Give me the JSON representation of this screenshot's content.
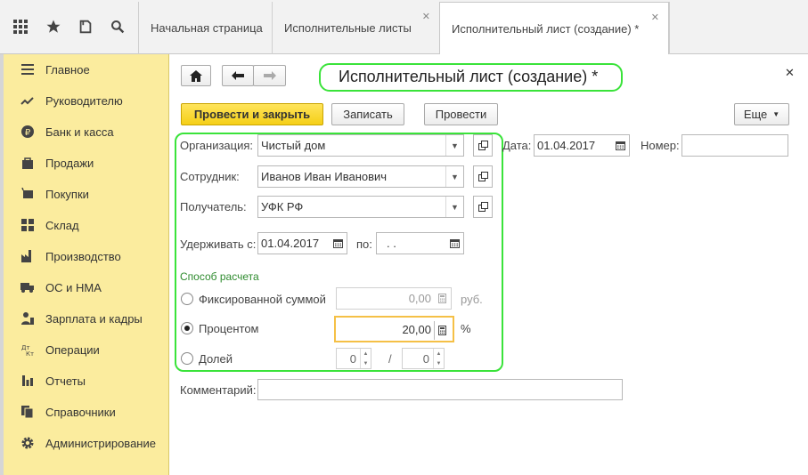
{
  "tabs": [
    {
      "label": "Начальная страница"
    },
    {
      "label": "Исполнительные листы"
    },
    {
      "label": "Исполнительный лист (создание) *"
    }
  ],
  "sidebar": {
    "items": [
      {
        "label": "Главное",
        "icon": "menu-lines-icon"
      },
      {
        "label": "Руководителю",
        "icon": "trend-icon"
      },
      {
        "label": "Банк и касса",
        "icon": "ruble-coin-icon"
      },
      {
        "label": "Продажи",
        "icon": "bag-icon"
      },
      {
        "label": "Покупки",
        "icon": "cart-icon"
      },
      {
        "label": "Склад",
        "icon": "warehouse-icon"
      },
      {
        "label": "Производство",
        "icon": "factory-icon"
      },
      {
        "label": "ОС и НМА",
        "icon": "truck-icon"
      },
      {
        "label": "Зарплата и кадры",
        "icon": "people-icon"
      },
      {
        "label": "Операции",
        "icon": "operations-icon"
      },
      {
        "label": "Отчеты",
        "icon": "bar-chart-icon"
      },
      {
        "label": "Справочники",
        "icon": "books-icon"
      },
      {
        "label": "Администрирование",
        "icon": "gear-icon"
      }
    ]
  },
  "form": {
    "title": "Исполнительный лист (создание) *",
    "buttons": {
      "post_close": "Провести и закрыть",
      "save": "Записать",
      "post": "Провести",
      "more": "Еще"
    },
    "organization": {
      "label": "Организация:",
      "value": "Чистый дом"
    },
    "date": {
      "label": "Дата:",
      "value": "01.04.2017"
    },
    "number": {
      "label": "Номер:",
      "value": ""
    },
    "employee": {
      "label": "Сотрудник:",
      "value": "Иванов Иван Иванович"
    },
    "recipient": {
      "label": "Получатель:",
      "value": "УФК РФ"
    },
    "withhold_from": {
      "label": "Удерживать с:",
      "value": "01.04.2017"
    },
    "withhold_to": {
      "label": "по:",
      "value": " .  ."
    },
    "calc_method": {
      "header": "Способ расчета",
      "fixed": {
        "label": "Фиксированной суммой",
        "value": "0,00",
        "unit": "руб."
      },
      "percent": {
        "label": "Процентом",
        "value": "20,00",
        "unit": "%"
      },
      "share": {
        "label": "Долей",
        "numerator": "0",
        "separator": "/",
        "denominator": "0"
      }
    },
    "comment": {
      "label": "Комментарий:",
      "value": ""
    }
  },
  "colors": {
    "sidebar_bg": "#fbec9e",
    "primary_button": "#f5cf17",
    "highlight": "#3ae33a",
    "focus": "#f5c046",
    "section_header": "#2e8b2e"
  }
}
